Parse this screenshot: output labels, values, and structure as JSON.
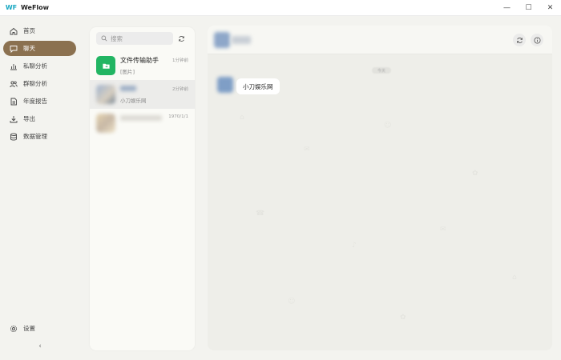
{
  "window": {
    "title": "WeFlow",
    "logo": "WF",
    "minimize": "—",
    "maximize": "☐",
    "close": "✕"
  },
  "sidebar": {
    "items": [
      {
        "label": "首页",
        "icon": "home-icon"
      },
      {
        "label": "聊天",
        "icon": "chat-bubble-icon"
      },
      {
        "label": "私聊分析",
        "icon": "bar-chart-icon"
      },
      {
        "label": "群聊分析",
        "icon": "users-icon"
      },
      {
        "label": "年度报告",
        "icon": "document-icon"
      },
      {
        "label": "导出",
        "icon": "download-icon"
      },
      {
        "label": "数据管理",
        "icon": "database-icon"
      }
    ],
    "settings_label": "设置",
    "collapse": "‹"
  },
  "conversation_list": {
    "search_placeholder": "搜索",
    "conversations": [
      {
        "name": "文件传输助手",
        "preview": "[图片]",
        "time": "1分钟前"
      },
      {
        "name": "",
        "preview": "小刀娱乐网",
        "time": "2分钟前"
      },
      {
        "name": "",
        "preview": "",
        "time": "1970/1/1"
      }
    ]
  },
  "chat": {
    "time_divider": "今天",
    "messages": [
      {
        "text": "小刀娱乐网"
      }
    ]
  },
  "colors": {
    "accent": "#8b7150",
    "file_helper_green": "#22b563",
    "background": "#f3f3ef"
  }
}
